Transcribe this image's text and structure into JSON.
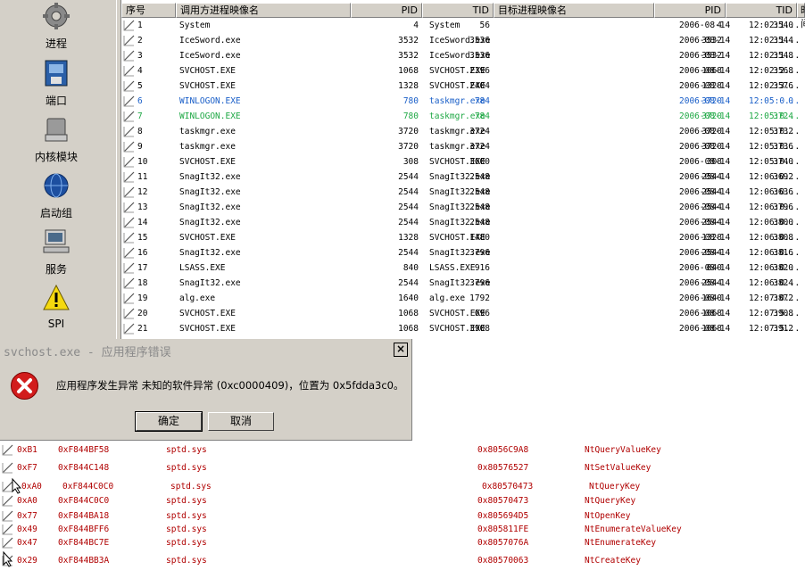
{
  "sidebar": {
    "items": [
      {
        "label": "进程",
        "icon": "gear-icon"
      },
      {
        "label": "端口",
        "icon": "network-port-icon"
      },
      {
        "label": "内核模块",
        "icon": "disk-module-icon"
      },
      {
        "label": "启动组",
        "icon": "globe-startup-icon"
      },
      {
        "label": "服务",
        "icon": "computer-service-icon"
      },
      {
        "label": "SPI",
        "icon": "warning-icon"
      }
    ]
  },
  "table": {
    "columns": [
      "序号",
      "调用方进程映像名",
      "PID",
      "TID",
      "目标进程映像名",
      "PID",
      "TID",
      "时间"
    ],
    "rows": [
      {
        "no": "1",
        "caller": "System",
        "pid": "4",
        "tid": "56",
        "target": "System",
        "tpid": "4",
        "ttid": "3540",
        "date": "2006-08-14",
        "time": "12:02:1...",
        "color": "#000000"
      },
      {
        "no": "2",
        "caller": "IceSword.exe",
        "pid": "3532",
        "tid": "3536",
        "target": "IceSword.exe",
        "tpid": "3532",
        "ttid": "3544",
        "date": "2006-08-14",
        "time": "12:02:1...",
        "color": "#000000"
      },
      {
        "no": "3",
        "caller": "IceSword.exe",
        "pid": "3532",
        "tid": "3536",
        "target": "IceSword.exe",
        "tpid": "3532",
        "ttid": "3548",
        "date": "2006-08-14",
        "time": "12:02:1...",
        "color": "#000000"
      },
      {
        "no": "4",
        "caller": "SVCHOST.EXE",
        "pid": "1068",
        "tid": "2396",
        "target": "SVCHOST.EXE",
        "tpid": "1068",
        "ttid": "3568",
        "date": "2006-08-14",
        "time": "12:02:2...",
        "color": "#000000"
      },
      {
        "no": "5",
        "caller": "SVCHOST.EXE",
        "pid": "1328",
        "tid": "2404",
        "target": "SVCHOST.EXE",
        "tpid": "1328",
        "ttid": "3576",
        "date": "2006-08-14",
        "time": "12:02:3...",
        "color": "#000000"
      },
      {
        "no": "6",
        "caller": "WINLOGON.EXE",
        "pid": "780",
        "tid": "784",
        "target": "taskmgr.exe",
        "tpid": "3720",
        "ttid": "0",
        "date": "2006-08-14",
        "time": "12:05:0...",
        "color": "#1a5fc8"
      },
      {
        "no": "7",
        "caller": "WINLOGON.EXE",
        "pid": "780",
        "tid": "784",
        "target": "taskmgr.exe",
        "tpid": "3720",
        "ttid": "3724",
        "date": "2006-08-14",
        "time": "12:05:0...",
        "color": "#1fa845"
      },
      {
        "no": "8",
        "caller": "taskmgr.exe",
        "pid": "3720",
        "tid": "3724",
        "target": "taskmgr.exe",
        "tpid": "3720",
        "ttid": "3732",
        "date": "2006-08-14",
        "time": "12:05:0...",
        "color": "#000000"
      },
      {
        "no": "9",
        "caller": "taskmgr.exe",
        "pid": "3720",
        "tid": "3724",
        "target": "taskmgr.exe",
        "tpid": "3720",
        "ttid": "3736",
        "date": "2006-08-14",
        "time": "12:05:0...",
        "color": "#000000"
      },
      {
        "no": "10",
        "caller": "SVCHOST.EXE",
        "pid": "308",
        "tid": "3600",
        "target": "SVCHOST.EXE",
        "tpid": "308",
        "ttid": "3740",
        "date": "2006-08-14",
        "time": "12:05:0...",
        "color": "#000000"
      },
      {
        "no": "11",
        "caller": "SnagIt32.exe",
        "pid": "2544",
        "tid": "2548",
        "target": "SnagIt32.exe",
        "tpid": "2544",
        "ttid": "3692",
        "date": "2006-08-14",
        "time": "12:06:0...",
        "color": "#000000"
      },
      {
        "no": "12",
        "caller": "SnagIt32.exe",
        "pid": "2544",
        "tid": "2548",
        "target": "SnagIt32.exe",
        "tpid": "2544",
        "ttid": "3636",
        "date": "2006-08-14",
        "time": "12:06:0...",
        "color": "#000000"
      },
      {
        "no": "13",
        "caller": "SnagIt32.exe",
        "pid": "2544",
        "tid": "2548",
        "target": "SnagIt32.exe",
        "tpid": "2544",
        "ttid": "3796",
        "date": "2006-08-14",
        "time": "12:06:0...",
        "color": "#000000"
      },
      {
        "no": "14",
        "caller": "SnagIt32.exe",
        "pid": "2544",
        "tid": "2548",
        "target": "SnagIt32.exe",
        "tpid": "2544",
        "ttid": "3800",
        "date": "2006-08-14",
        "time": "12:06:0...",
        "color": "#000000"
      },
      {
        "no": "15",
        "caller": "SVCHOST.EXE",
        "pid": "1328",
        "tid": "1480",
        "target": "SVCHOST.EXE",
        "tpid": "1328",
        "ttid": "3808",
        "date": "2006-08-14",
        "time": "12:06:0...",
        "color": "#000000"
      },
      {
        "no": "16",
        "caller": "SnagIt32.exe",
        "pid": "2544",
        "tid": "3796",
        "target": "SnagIt32.exe",
        "tpid": "2544",
        "ttid": "3816",
        "date": "2006-08-14",
        "time": "12:06:0...",
        "color": "#000000"
      },
      {
        "no": "17",
        "caller": "LSASS.EXE",
        "pid": "840",
        "tid": "916",
        "target": "LSASS.EXE",
        "tpid": "840",
        "ttid": "3820",
        "date": "2006-08-14",
        "time": "12:06:0...",
        "color": "#000000"
      },
      {
        "no": "18",
        "caller": "SnagIt32.exe",
        "pid": "2544",
        "tid": "3796",
        "target": "SnagIt32.exe",
        "tpid": "2544",
        "ttid": "3824",
        "date": "2006-08-14",
        "time": "12:06:0...",
        "color": "#000000"
      },
      {
        "no": "19",
        "caller": "alg.exe",
        "pid": "1640",
        "tid": "1792",
        "target": "alg.exe",
        "tpid": "1640",
        "ttid": "3872",
        "date": "2006-08-14",
        "time": "12:07:0...",
        "color": "#000000"
      },
      {
        "no": "20",
        "caller": "SVCHOST.EXE",
        "pid": "1068",
        "tid": "696",
        "target": "SVCHOST.EXE",
        "tpid": "1068",
        "ttid": "3908",
        "date": "2006-08-14",
        "time": "12:07:5...",
        "color": "#000000"
      },
      {
        "no": "21",
        "caller": "SVCHOST.EXE",
        "pid": "1068",
        "tid": "3908",
        "target": "SVCHOST.EXE",
        "tpid": "1068",
        "ttid": "3912",
        "date": "2006-08-14",
        "time": "12:07:5...",
        "color": "#000000"
      }
    ]
  },
  "dialog": {
    "title": "svchost.exe - 应用程序错误",
    "close": "×",
    "message": "应用程序发生异常 未知的软件异常 (0xc0000409)，位置为 0x5fdda3c0。",
    "ok": "确定",
    "cancel": "取消",
    "icon": "error-icon"
  },
  "lower_list": {
    "rows": [
      {
        "idx": "0xB1",
        "addr": "0xF844BF58",
        "mod": "sptd.sys",
        "orig": "0x8056C9A8",
        "func": "NtQueryValueKey"
      },
      {
        "idx": "0xF7",
        "addr": "0xF844C148",
        "mod": "sptd.sys",
        "orig": "0x80576527",
        "func": "NtSetValueKey"
      },
      {
        "idx": "0xA0",
        "addr": "0xF844C0C0",
        "mod": "sptd.sys",
        "orig": "0x80570473",
        "func": "NtQueryKey"
      },
      {
        "idx": "0xA0",
        "addr": "0xF844C0C0",
        "mod": "sptd.sys",
        "orig": "0x80570473",
        "func": "NtQueryKey"
      },
      {
        "idx": "0x77",
        "addr": "0xF844BA18",
        "mod": "sptd.sys",
        "orig": "0x805694D5",
        "func": "NtOpenKey"
      },
      {
        "idx": "0x49",
        "addr": "0xF844BFF6",
        "mod": "sptd.sys",
        "orig": "0x805811FE",
        "func": "NtEnumerateValueKey"
      },
      {
        "idx": "0x47",
        "addr": "0xF844BC7E",
        "mod": "sptd.sys",
        "orig": "0x8057076A",
        "func": "NtEnumerateKey"
      },
      {
        "idx": "0x29",
        "addr": "0xF844BB3A",
        "mod": "sptd.sys",
        "orig": "0x80570063",
        "func": "NtCreateKey"
      }
    ]
  },
  "colors": {
    "face": "#d4d0c8",
    "lower_text": "#b00000",
    "highlight_blue": "#1a5fc8",
    "highlight_green": "#1fa845"
  }
}
